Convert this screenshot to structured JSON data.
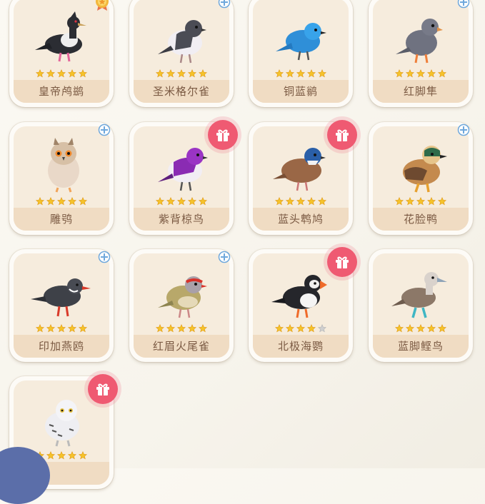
{
  "birds": [
    {
      "name": "皇帝鸬鹚",
      "stars": 5,
      "badge": "medal-icon"
    },
    {
      "name": "圣米格尔雀",
      "stars": 5,
      "badge": "collect-icon"
    },
    {
      "name": "铜蓝鹟",
      "stars": 5,
      "badge": ""
    },
    {
      "name": "红脚隼",
      "stars": 5,
      "badge": "collect-icon"
    },
    {
      "name": "雕鸮",
      "stars": 5,
      "badge": "collect-icon"
    },
    {
      "name": "紫背椋鸟",
      "stars": 5,
      "badge": "gift-icon"
    },
    {
      "name": "蓝头鹎鸠",
      "stars": 5,
      "badge": "gift-icon"
    },
    {
      "name": "花脸鸭",
      "stars": 5,
      "badge": "collect-icon"
    },
    {
      "name": "印加燕鸥",
      "stars": 5,
      "badge": "collect-icon"
    },
    {
      "name": "红眉火尾雀",
      "stars": 5,
      "badge": "collect-icon"
    },
    {
      "name": "北极海鹦",
      "stars": 4,
      "badge": "gift-icon"
    },
    {
      "name": "蓝脚鲣鸟",
      "stars": 5,
      "badge": ""
    },
    {
      "name": "",
      "stars": 5,
      "badge": "gift-icon"
    }
  ],
  "colors": {
    "star_on": "#f5c32a",
    "star_off": "#cfcfcf",
    "gift": "#ef5a72",
    "label_bg": "#f0dcc3",
    "label_text": "#7b5a43"
  }
}
